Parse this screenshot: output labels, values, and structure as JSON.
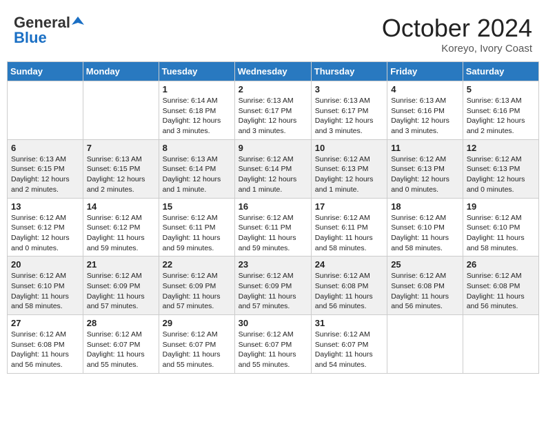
{
  "logo": {
    "line1": "General",
    "line2": "Blue"
  },
  "title": "October 2024",
  "location": "Koreyo, Ivory Coast",
  "days_of_week": [
    "Sunday",
    "Monday",
    "Tuesday",
    "Wednesday",
    "Thursday",
    "Friday",
    "Saturday"
  ],
  "weeks": [
    [
      {
        "day": "",
        "info": ""
      },
      {
        "day": "",
        "info": ""
      },
      {
        "day": "1",
        "info": "Sunrise: 6:14 AM\nSunset: 6:18 PM\nDaylight: 12 hours and 3 minutes."
      },
      {
        "day": "2",
        "info": "Sunrise: 6:13 AM\nSunset: 6:17 PM\nDaylight: 12 hours and 3 minutes."
      },
      {
        "day": "3",
        "info": "Sunrise: 6:13 AM\nSunset: 6:17 PM\nDaylight: 12 hours and 3 minutes."
      },
      {
        "day": "4",
        "info": "Sunrise: 6:13 AM\nSunset: 6:16 PM\nDaylight: 12 hours and 3 minutes."
      },
      {
        "day": "5",
        "info": "Sunrise: 6:13 AM\nSunset: 6:16 PM\nDaylight: 12 hours and 2 minutes."
      }
    ],
    [
      {
        "day": "6",
        "info": "Sunrise: 6:13 AM\nSunset: 6:15 PM\nDaylight: 12 hours and 2 minutes."
      },
      {
        "day": "7",
        "info": "Sunrise: 6:13 AM\nSunset: 6:15 PM\nDaylight: 12 hours and 2 minutes."
      },
      {
        "day": "8",
        "info": "Sunrise: 6:13 AM\nSunset: 6:14 PM\nDaylight: 12 hours and 1 minute."
      },
      {
        "day": "9",
        "info": "Sunrise: 6:12 AM\nSunset: 6:14 PM\nDaylight: 12 hours and 1 minute."
      },
      {
        "day": "10",
        "info": "Sunrise: 6:12 AM\nSunset: 6:13 PM\nDaylight: 12 hours and 1 minute."
      },
      {
        "day": "11",
        "info": "Sunrise: 6:12 AM\nSunset: 6:13 PM\nDaylight: 12 hours and 0 minutes."
      },
      {
        "day": "12",
        "info": "Sunrise: 6:12 AM\nSunset: 6:13 PM\nDaylight: 12 hours and 0 minutes."
      }
    ],
    [
      {
        "day": "13",
        "info": "Sunrise: 6:12 AM\nSunset: 6:12 PM\nDaylight: 12 hours and 0 minutes."
      },
      {
        "day": "14",
        "info": "Sunrise: 6:12 AM\nSunset: 6:12 PM\nDaylight: 11 hours and 59 minutes."
      },
      {
        "day": "15",
        "info": "Sunrise: 6:12 AM\nSunset: 6:11 PM\nDaylight: 11 hours and 59 minutes."
      },
      {
        "day": "16",
        "info": "Sunrise: 6:12 AM\nSunset: 6:11 PM\nDaylight: 11 hours and 59 minutes."
      },
      {
        "day": "17",
        "info": "Sunrise: 6:12 AM\nSunset: 6:11 PM\nDaylight: 11 hours and 58 minutes."
      },
      {
        "day": "18",
        "info": "Sunrise: 6:12 AM\nSunset: 6:10 PM\nDaylight: 11 hours and 58 minutes."
      },
      {
        "day": "19",
        "info": "Sunrise: 6:12 AM\nSunset: 6:10 PM\nDaylight: 11 hours and 58 minutes."
      }
    ],
    [
      {
        "day": "20",
        "info": "Sunrise: 6:12 AM\nSunset: 6:10 PM\nDaylight: 11 hours and 58 minutes."
      },
      {
        "day": "21",
        "info": "Sunrise: 6:12 AM\nSunset: 6:09 PM\nDaylight: 11 hours and 57 minutes."
      },
      {
        "day": "22",
        "info": "Sunrise: 6:12 AM\nSunset: 6:09 PM\nDaylight: 11 hours and 57 minutes."
      },
      {
        "day": "23",
        "info": "Sunrise: 6:12 AM\nSunset: 6:09 PM\nDaylight: 11 hours and 57 minutes."
      },
      {
        "day": "24",
        "info": "Sunrise: 6:12 AM\nSunset: 6:08 PM\nDaylight: 11 hours and 56 minutes."
      },
      {
        "day": "25",
        "info": "Sunrise: 6:12 AM\nSunset: 6:08 PM\nDaylight: 11 hours and 56 minutes."
      },
      {
        "day": "26",
        "info": "Sunrise: 6:12 AM\nSunset: 6:08 PM\nDaylight: 11 hours and 56 minutes."
      }
    ],
    [
      {
        "day": "27",
        "info": "Sunrise: 6:12 AM\nSunset: 6:08 PM\nDaylight: 11 hours and 56 minutes."
      },
      {
        "day": "28",
        "info": "Sunrise: 6:12 AM\nSunset: 6:07 PM\nDaylight: 11 hours and 55 minutes."
      },
      {
        "day": "29",
        "info": "Sunrise: 6:12 AM\nSunset: 6:07 PM\nDaylight: 11 hours and 55 minutes."
      },
      {
        "day": "30",
        "info": "Sunrise: 6:12 AM\nSunset: 6:07 PM\nDaylight: 11 hours and 55 minutes."
      },
      {
        "day": "31",
        "info": "Sunrise: 6:12 AM\nSunset: 6:07 PM\nDaylight: 11 hours and 54 minutes."
      },
      {
        "day": "",
        "info": ""
      },
      {
        "day": "",
        "info": ""
      }
    ]
  ]
}
